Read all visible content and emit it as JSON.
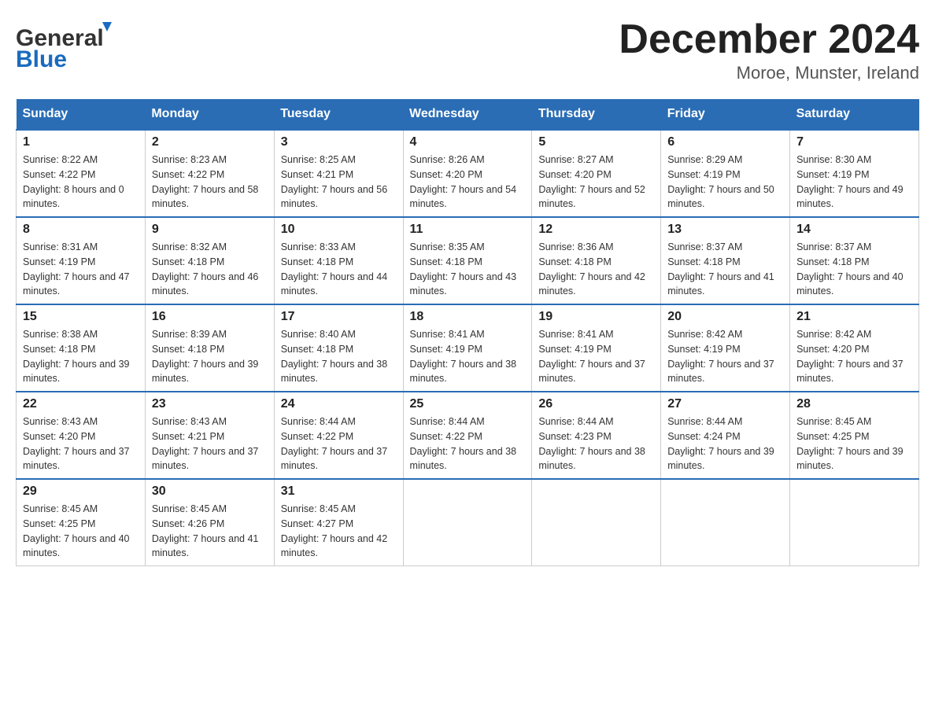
{
  "header": {
    "logo_general": "General",
    "logo_blue": "Blue",
    "month_title": "December 2024",
    "location": "Moroe, Munster, Ireland"
  },
  "days_of_week": [
    "Sunday",
    "Monday",
    "Tuesday",
    "Wednesday",
    "Thursday",
    "Friday",
    "Saturday"
  ],
  "weeks": [
    [
      {
        "day": "1",
        "sunrise": "8:22 AM",
        "sunset": "4:22 PM",
        "daylight": "8 hours and 0 minutes."
      },
      {
        "day": "2",
        "sunrise": "8:23 AM",
        "sunset": "4:22 PM",
        "daylight": "7 hours and 58 minutes."
      },
      {
        "day": "3",
        "sunrise": "8:25 AM",
        "sunset": "4:21 PM",
        "daylight": "7 hours and 56 minutes."
      },
      {
        "day": "4",
        "sunrise": "8:26 AM",
        "sunset": "4:20 PM",
        "daylight": "7 hours and 54 minutes."
      },
      {
        "day": "5",
        "sunrise": "8:27 AM",
        "sunset": "4:20 PM",
        "daylight": "7 hours and 52 minutes."
      },
      {
        "day": "6",
        "sunrise": "8:29 AM",
        "sunset": "4:19 PM",
        "daylight": "7 hours and 50 minutes."
      },
      {
        "day": "7",
        "sunrise": "8:30 AM",
        "sunset": "4:19 PM",
        "daylight": "7 hours and 49 minutes."
      }
    ],
    [
      {
        "day": "8",
        "sunrise": "8:31 AM",
        "sunset": "4:19 PM",
        "daylight": "7 hours and 47 minutes."
      },
      {
        "day": "9",
        "sunrise": "8:32 AM",
        "sunset": "4:18 PM",
        "daylight": "7 hours and 46 minutes."
      },
      {
        "day": "10",
        "sunrise": "8:33 AM",
        "sunset": "4:18 PM",
        "daylight": "7 hours and 44 minutes."
      },
      {
        "day": "11",
        "sunrise": "8:35 AM",
        "sunset": "4:18 PM",
        "daylight": "7 hours and 43 minutes."
      },
      {
        "day": "12",
        "sunrise": "8:36 AM",
        "sunset": "4:18 PM",
        "daylight": "7 hours and 42 minutes."
      },
      {
        "day": "13",
        "sunrise": "8:37 AM",
        "sunset": "4:18 PM",
        "daylight": "7 hours and 41 minutes."
      },
      {
        "day": "14",
        "sunrise": "8:37 AM",
        "sunset": "4:18 PM",
        "daylight": "7 hours and 40 minutes."
      }
    ],
    [
      {
        "day": "15",
        "sunrise": "8:38 AM",
        "sunset": "4:18 PM",
        "daylight": "7 hours and 39 minutes."
      },
      {
        "day": "16",
        "sunrise": "8:39 AM",
        "sunset": "4:18 PM",
        "daylight": "7 hours and 39 minutes."
      },
      {
        "day": "17",
        "sunrise": "8:40 AM",
        "sunset": "4:18 PM",
        "daylight": "7 hours and 38 minutes."
      },
      {
        "day": "18",
        "sunrise": "8:41 AM",
        "sunset": "4:19 PM",
        "daylight": "7 hours and 38 minutes."
      },
      {
        "day": "19",
        "sunrise": "8:41 AM",
        "sunset": "4:19 PM",
        "daylight": "7 hours and 37 minutes."
      },
      {
        "day": "20",
        "sunrise": "8:42 AM",
        "sunset": "4:19 PM",
        "daylight": "7 hours and 37 minutes."
      },
      {
        "day": "21",
        "sunrise": "8:42 AM",
        "sunset": "4:20 PM",
        "daylight": "7 hours and 37 minutes."
      }
    ],
    [
      {
        "day": "22",
        "sunrise": "8:43 AM",
        "sunset": "4:20 PM",
        "daylight": "7 hours and 37 minutes."
      },
      {
        "day": "23",
        "sunrise": "8:43 AM",
        "sunset": "4:21 PM",
        "daylight": "7 hours and 37 minutes."
      },
      {
        "day": "24",
        "sunrise": "8:44 AM",
        "sunset": "4:22 PM",
        "daylight": "7 hours and 37 minutes."
      },
      {
        "day": "25",
        "sunrise": "8:44 AM",
        "sunset": "4:22 PM",
        "daylight": "7 hours and 38 minutes."
      },
      {
        "day": "26",
        "sunrise": "8:44 AM",
        "sunset": "4:23 PM",
        "daylight": "7 hours and 38 minutes."
      },
      {
        "day": "27",
        "sunrise": "8:44 AM",
        "sunset": "4:24 PM",
        "daylight": "7 hours and 39 minutes."
      },
      {
        "day": "28",
        "sunrise": "8:45 AM",
        "sunset": "4:25 PM",
        "daylight": "7 hours and 39 minutes."
      }
    ],
    [
      {
        "day": "29",
        "sunrise": "8:45 AM",
        "sunset": "4:25 PM",
        "daylight": "7 hours and 40 minutes."
      },
      {
        "day": "30",
        "sunrise": "8:45 AM",
        "sunset": "4:26 PM",
        "daylight": "7 hours and 41 minutes."
      },
      {
        "day": "31",
        "sunrise": "8:45 AM",
        "sunset": "4:27 PM",
        "daylight": "7 hours and 42 minutes."
      },
      null,
      null,
      null,
      null
    ]
  ]
}
